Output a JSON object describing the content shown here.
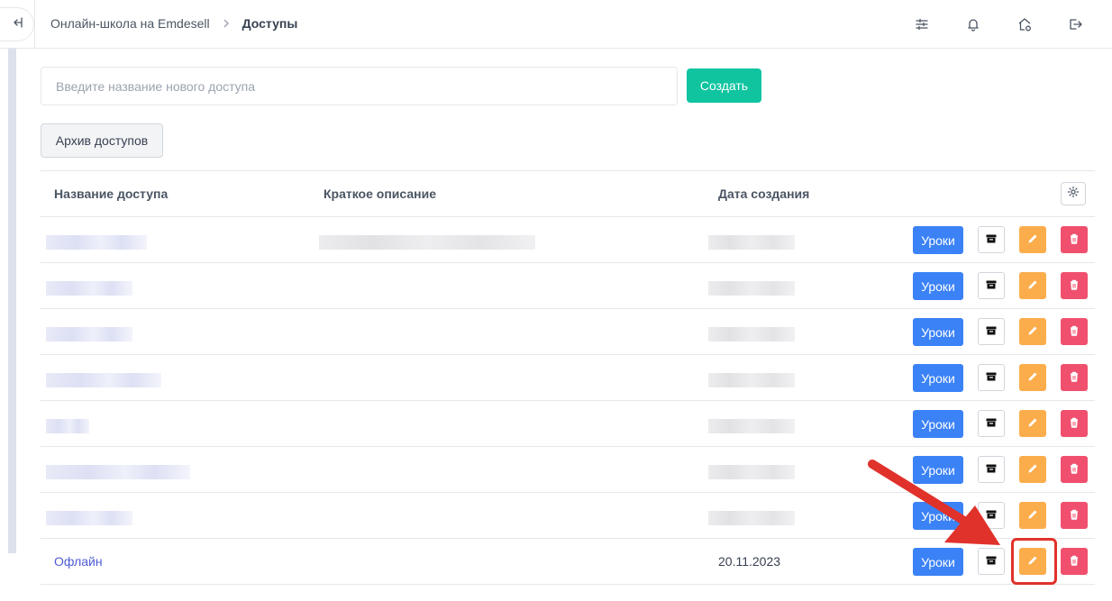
{
  "header": {
    "breadcrumb_root": "Онлайн-школа на Emdesell",
    "breadcrumb_current": "Доступы",
    "icons": [
      "collapse-sidebar-icon",
      "chevron-right-icon",
      "filter-sliders-icon",
      "bell-icon",
      "home-settings-icon",
      "logout-icon"
    ]
  },
  "form": {
    "new_access_placeholder": "Введите название нового доступа",
    "create_label": "Создать",
    "archive_label": "Архив доступов"
  },
  "table": {
    "columns": [
      "Название доступа",
      "Краткое описание",
      "Дата создания"
    ],
    "settings_icon": "gear-icon",
    "rows": [
      {
        "name": "",
        "description": "",
        "date": "",
        "name_redacted": true,
        "desc_redacted": true,
        "date_redacted": true
      },
      {
        "name": "",
        "description": "",
        "date": "",
        "name_redacted": true,
        "desc_redacted": false,
        "date_redacted": true
      },
      {
        "name": "",
        "description": "",
        "date": "",
        "name_redacted": true,
        "desc_redacted": false,
        "date_redacted": true
      },
      {
        "name": "",
        "description": "",
        "date": "",
        "name_redacted": true,
        "desc_redacted": false,
        "date_redacted": true
      },
      {
        "name": "",
        "description": "",
        "date": "",
        "name_redacted": true,
        "desc_redacted": false,
        "date_redacted": true
      },
      {
        "name": "",
        "description": "",
        "date": "",
        "name_redacted": true,
        "desc_redacted": false,
        "date_redacted": true
      },
      {
        "name": "",
        "description": "",
        "date": "",
        "name_redacted": true,
        "desc_redacted": false,
        "date_redacted": true
      },
      {
        "name": "Офлайн",
        "description": "",
        "date": "20.11.2023",
        "name_redacted": false,
        "desc_redacted": false,
        "date_redacted": false
      }
    ],
    "lessons_label": "Уроки",
    "row_action_icons": [
      "archive-box-icon",
      "pencil-icon",
      "trash-icon"
    ]
  },
  "annotation": {
    "highlight_color": "#e0322b",
    "target": "edit-button-row-8"
  },
  "colors": {
    "create": "#10c4a0",
    "lessons": "#3b82f6",
    "edit": "#fbad4c",
    "delete": "#f0506e",
    "link": "#4f5bd5"
  }
}
